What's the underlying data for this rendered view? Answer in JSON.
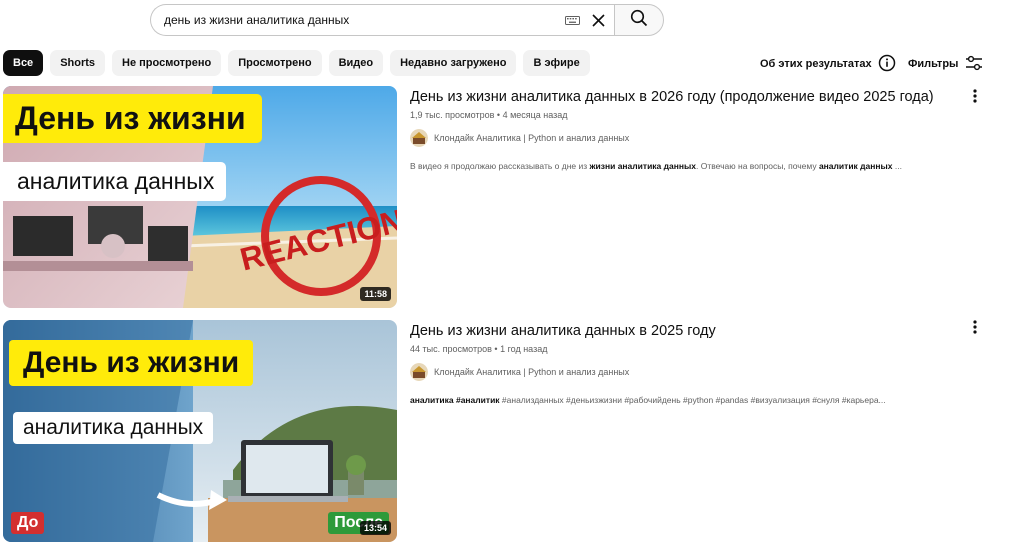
{
  "search": {
    "query": "день из жизни аналитика данных",
    "keyboard_icon": "keyboard-icon",
    "clear_icon": "close-icon",
    "search_icon": "search-icon"
  },
  "chips": [
    {
      "label": "Все",
      "active": true
    },
    {
      "label": "Shorts",
      "active": false
    },
    {
      "label": "Не просмотрено",
      "active": false
    },
    {
      "label": "Просмотрено",
      "active": false
    },
    {
      "label": "Видео",
      "active": false
    },
    {
      "label": "Недавно загружено",
      "active": false
    },
    {
      "label": "В эфире",
      "active": false
    }
  ],
  "about_results": {
    "label": "Об этих результатах",
    "icon": "info-icon"
  },
  "filters": {
    "label": "Фильтры",
    "icon": "sliders-icon"
  },
  "results": [
    {
      "title": "День из жизни аналитика данных в 2026 году (продолжение видео 2025 года)",
      "views": "1,9 тыс. просмотров",
      "age": "4 месяца назад",
      "channel": "Клондайк Аналитика | Python и анализ данных",
      "snippet": {
        "p1": "В видео я продолжаю рассказывать о дне из ",
        "b1": "жизни аналитика данных",
        "p2": ". Отвечаю на вопросы, почему ",
        "b2": "аналитик данных",
        "p3": " ..."
      },
      "duration": "11:58",
      "thumb": {
        "line1": "День из жизни",
        "line2": "аналитика данных",
        "stamp": "REACTION"
      }
    },
    {
      "title": "День из жизни аналитика данных в 2025 году",
      "views": "44 тыс. просмотров",
      "age": "1 год назад",
      "channel": "Клондайк Аналитика | Python и анализ данных",
      "snippet": {
        "b1": "аналитика",
        "p1": " ",
        "b2": "#аналитик",
        "p2": " #анализданных #деньизжизни #рабочийдень #python #pandas #визуализация #снуля #карьерa..."
      },
      "duration": "13:54",
      "thumb": {
        "line1": "День из жизни",
        "line2": "аналитика данных",
        "tag_left": "До",
        "tag_right": "После"
      }
    }
  ],
  "colors": {
    "chip_bg": "#f2f2f2",
    "chip_active": "#0f0f0f",
    "secondary_text": "#606060",
    "thumb_yellow": "#ffeb0a",
    "stamp_red": "#d42a2a"
  }
}
